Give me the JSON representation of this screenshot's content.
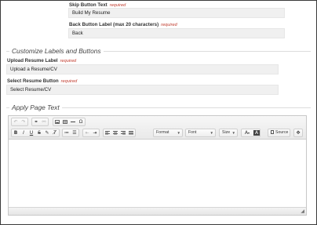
{
  "fields": {
    "skip_button": {
      "label": "Skip Button Text",
      "required": "required",
      "value": "Build My Resume"
    },
    "back_button": {
      "label": "Back Button Label (max 20 characters)",
      "required": "required",
      "value": "Back"
    },
    "upload_resume": {
      "label": "Upload Resume Label",
      "required": "required",
      "value": "Upload a Resume/CV"
    },
    "select_resume": {
      "label": "Select Resume Button",
      "required": "required",
      "value": "Select Resume/CV"
    }
  },
  "sections": {
    "customize": "Customize Labels and Buttons",
    "apply_page": "Apply Page Text"
  },
  "toolbar": {
    "format": "Format",
    "font": "Font",
    "size": "Size",
    "source": "Source",
    "icons": [
      "undo-icon",
      "redo-icon",
      "link-icon",
      "unlink-icon",
      "image-icon",
      "table-icon",
      "horizontal-rule-icon",
      "special-char-icon",
      "bold-icon",
      "italic-icon",
      "underline-icon",
      "strikethrough-icon",
      "remove-format-icon",
      "clear-format-icon",
      "numbered-list-icon",
      "bulleted-list-icon",
      "outdent-icon",
      "indent-icon",
      "align-left-icon",
      "align-center-icon",
      "align-right-icon",
      "justify-icon",
      "text-color-icon",
      "background-color-icon",
      "source-icon",
      "maximize-icon"
    ]
  },
  "colors": {
    "required": "#c0392b",
    "input_bg": "#f0f0f0"
  }
}
